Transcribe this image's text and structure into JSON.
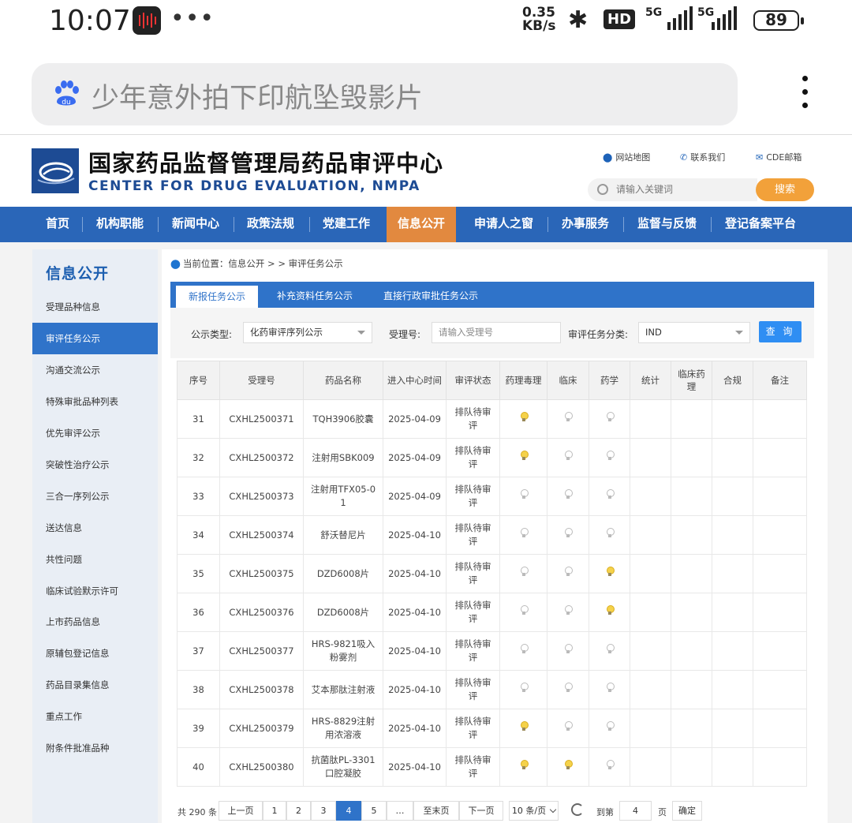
{
  "status_bar": {
    "time": "10:07",
    "net_speed_value": "0.35",
    "net_speed_unit": "KB/s",
    "hd_badge": "HD",
    "network_1": "5G",
    "network_2": "5G",
    "battery": "89"
  },
  "browser": {
    "search_query": "少年意外拍下印航坠毁影片"
  },
  "site": {
    "title_cn": "国家药品监督管理局药品审评中心",
    "title_en": "CENTER FOR DRUG EVALUATION, NMPA",
    "links": {
      "sitemap": "网站地图",
      "contact": "联系我们",
      "mail": "CDE邮箱"
    },
    "keyword_placeholder": "请输入关键词",
    "search_button": "搜索"
  },
  "nav": [
    "首页",
    "机构职能",
    "新闻中心",
    "政策法规",
    "党建工作",
    "信息公开",
    "申请人之窗",
    "办事服务",
    "监督与反馈",
    "登记备案平台"
  ],
  "sidebar": {
    "title": "信息公开",
    "items": [
      "受理品种信息",
      "审评任务公示",
      "沟通交流公示",
      "特殊审批品种列表",
      "优先审评公示",
      "突破性治疗公示",
      "三合一序列公示",
      "送达信息",
      "共性问题",
      "临床试验默示许可",
      "上市药品信息",
      "原辅包登记信息",
      "药品目录集信息",
      "重点工作",
      "附条件批准品种"
    ]
  },
  "breadcrumb": {
    "prefix": "当前位置：",
    "level1": "信息公开",
    "sep": " > > ",
    "level2": "审评任务公示"
  },
  "tabs": [
    "新报任务公示",
    "补充资料任务公示",
    "直接行政审批任务公示"
  ],
  "filter": {
    "type_label": "公示类型:",
    "type_value": "化药审评序列公示",
    "accept_label": "受理号:",
    "accept_placeholder": "请输入受理号",
    "category_label": "审评任务分类:",
    "category_value": "IND",
    "query_button": "查 询"
  },
  "table": {
    "headers": [
      "序号",
      "受理号",
      "药品名称",
      "进入中心时间",
      "审评状态",
      "药理毒理",
      "临床",
      "药学",
      "统计",
      "临床药理",
      "合规",
      "备注"
    ],
    "rows": [
      {
        "no": "31",
        "id": "CXHL2500371",
        "name": "TQH3906胶囊",
        "date": "2025-04-09",
        "status": "排队待审评",
        "tox": true,
        "clin": false,
        "pharm": false
      },
      {
        "no": "32",
        "id": "CXHL2500372",
        "name": "注射用SBK009",
        "date": "2025-04-09",
        "status": "排队待审评",
        "tox": true,
        "clin": false,
        "pharm": false
      },
      {
        "no": "33",
        "id": "CXHL2500373",
        "name": "注射用TFX05-01",
        "date": "2025-04-09",
        "status": "排队待审评",
        "tox": false,
        "clin": false,
        "pharm": false
      },
      {
        "no": "34",
        "id": "CXHL2500374",
        "name": "舒沃替尼片",
        "date": "2025-04-10",
        "status": "排队待审评",
        "tox": false,
        "clin": false,
        "pharm": false
      },
      {
        "no": "35",
        "id": "CXHL2500375",
        "name": "DZD6008片",
        "date": "2025-04-10",
        "status": "排队待审评",
        "tox": false,
        "clin": false,
        "pharm": true
      },
      {
        "no": "36",
        "id": "CXHL2500376",
        "name": "DZD6008片",
        "date": "2025-04-10",
        "status": "排队待审评",
        "tox": false,
        "clin": false,
        "pharm": true
      },
      {
        "no": "37",
        "id": "CXHL2500377",
        "name": "HRS-9821吸入粉雾剂",
        "date": "2025-04-10",
        "status": "排队待审评",
        "tox": false,
        "clin": false,
        "pharm": false
      },
      {
        "no": "38",
        "id": "CXHL2500378",
        "name": "艾本那肽注射液",
        "date": "2025-04-10",
        "status": "排队待审评",
        "tox": false,
        "clin": false,
        "pharm": false
      },
      {
        "no": "39",
        "id": "CXHL2500379",
        "name": "HRS-8829注射用浓溶液",
        "date": "2025-04-10",
        "status": "排队待审评",
        "tox": true,
        "clin": false,
        "pharm": false
      },
      {
        "no": "40",
        "id": "CXHL2500380",
        "name": "抗菌肽PL-3301口腔凝胶",
        "date": "2025-04-10",
        "status": "排队待审评",
        "tox": true,
        "clin": true,
        "pharm": false
      }
    ]
  },
  "pager": {
    "total": "共 290 条",
    "prev": "上一页",
    "pages": [
      "1",
      "2",
      "3",
      "4",
      "5"
    ],
    "current": "4",
    "ellipsis": "…",
    "last": "至末页",
    "next": "下一页",
    "per_page": "10 条/页",
    "goto_label": "到第",
    "goto_value": "4",
    "page_suffix": "页",
    "confirm": "确定"
  }
}
